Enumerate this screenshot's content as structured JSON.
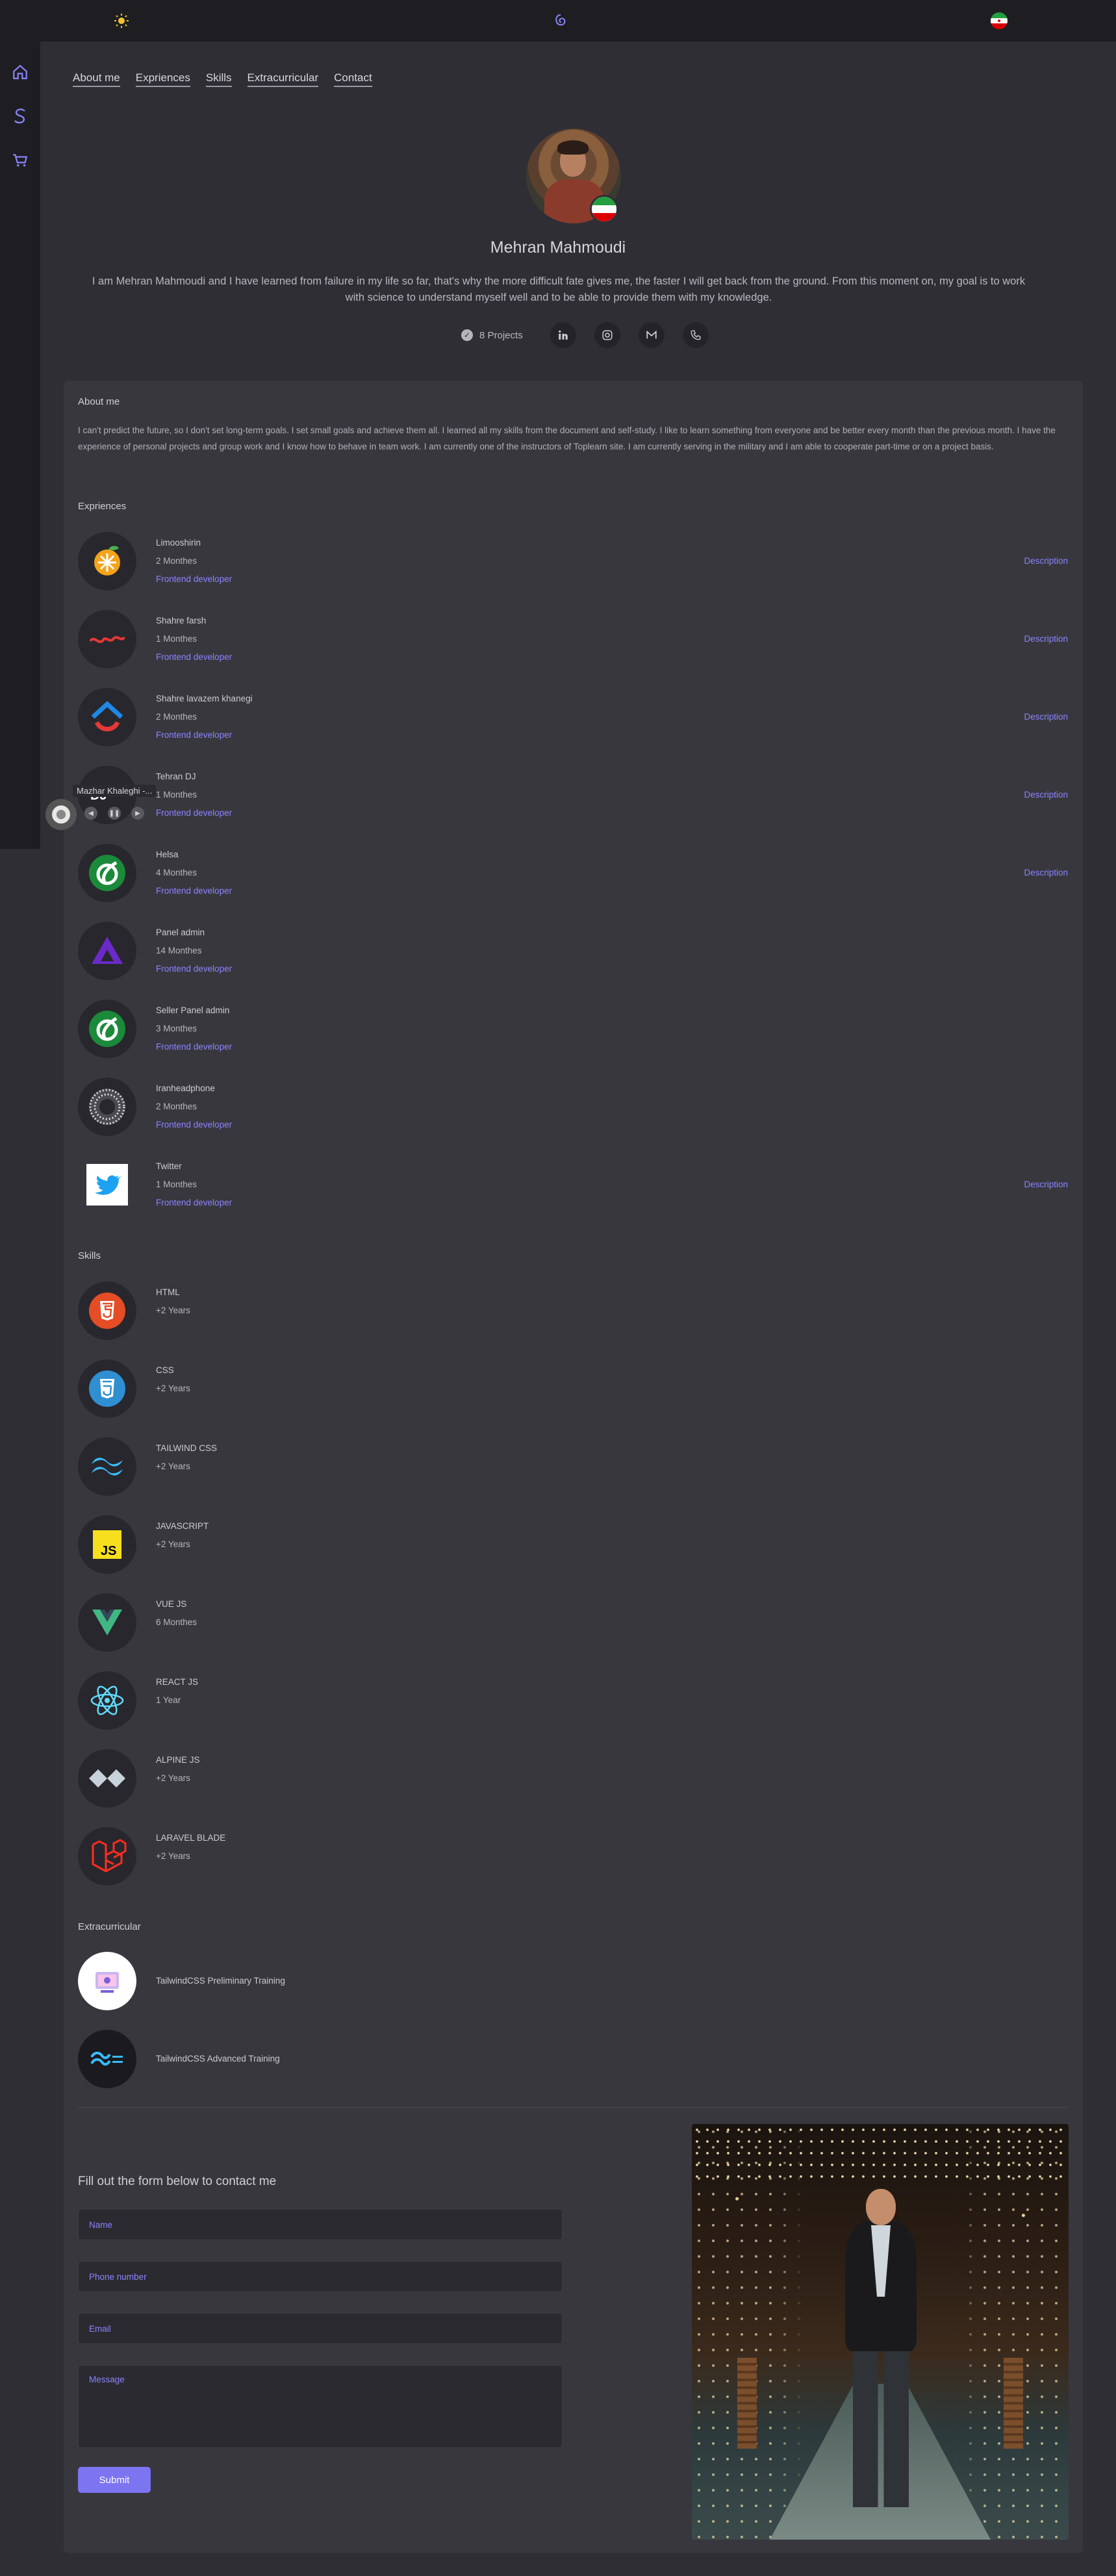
{
  "nav": [
    "About me",
    "Expriences",
    "Skills",
    "Extracurricular",
    "Contact"
  ],
  "profile": {
    "name": "Mehran Mahmoudi",
    "bio": "I am Mehran Mahmoudi and I have learned from failure in my life so far, that's why the more difficult fate gives me, the faster I will get back from the ground. From this moment on, my goal is to work with science to understand myself well and to be able to provide them with my knowledge.",
    "projects": "8 Projects"
  },
  "about": {
    "title": "About me",
    "text": "I can't predict the future, so I don't set long-term goals. I set small goals and achieve them all. I learned all my skills from the document and self-study. I like to learn something from everyone and be better every month than the previous month. I have the experience of personal projects and group work and I know how to behave in team work. I am currently one of the instructors of Toplearn site. I am currently serving in the military and I am able to cooperate part-time or on a project basis."
  },
  "experiences": {
    "title": "Expriences",
    "items": [
      {
        "name": "Limooshirin",
        "duration": "2 Monthes",
        "role": "Frontend developer",
        "link": "Description"
      },
      {
        "name": "Shahre farsh",
        "duration": "1 Monthes",
        "role": "Frontend developer",
        "link": "Description"
      },
      {
        "name": "Shahre lavazem khanegi",
        "duration": "2 Monthes",
        "role": "Frontend developer",
        "link": "Description"
      },
      {
        "name": "Tehran DJ",
        "duration": "1 Monthes",
        "role": "Frontend developer",
        "link": "Description"
      },
      {
        "name": "Helsa",
        "duration": "4 Monthes",
        "role": "Frontend developer",
        "link": "Description"
      },
      {
        "name": "Panel admin",
        "duration": "14 Monthes",
        "role": "Frontend developer",
        "link": ""
      },
      {
        "name": "Seller Panel admin",
        "duration": "3 Monthes",
        "role": "Frontend developer",
        "link": ""
      },
      {
        "name": "Iranheadphone",
        "duration": "2 Monthes",
        "role": "Frontend developer",
        "link": ""
      },
      {
        "name": "Twitter",
        "duration": "1 Monthes",
        "role": "Frontend developer",
        "link": "Description"
      }
    ]
  },
  "skills": {
    "title": "Skills",
    "items": [
      {
        "name": "HTML",
        "years": "+2 Years"
      },
      {
        "name": "CSS",
        "years": "+2 Years"
      },
      {
        "name": "TAILWIND CSS",
        "years": "+2 Years"
      },
      {
        "name": "JAVASCRIPT",
        "years": "+2 Years"
      },
      {
        "name": "VUE JS",
        "years": "6 Monthes"
      },
      {
        "name": "REACT JS",
        "years": "1 Year"
      },
      {
        "name": "ALPINE JS",
        "years": "+2 Years"
      },
      {
        "name": "LARAVEL BLADE",
        "years": "+2 Years"
      }
    ]
  },
  "extracurricular": {
    "title": "Extracurricular",
    "items": [
      "TailwindCSS Preliminary Training",
      "TailwindCSS Advanced Training"
    ]
  },
  "contact": {
    "title": "Fill out the form below to contact me",
    "name_placeholder": "Name",
    "phone_placeholder": "Phone number",
    "email_placeholder": "Email",
    "message_placeholder": "Message",
    "submit": "Submit"
  },
  "player": {
    "title": "Mazhar Khaleghi -..."
  },
  "colors": {
    "accent": "#8a84ff",
    "button": "#7c74f0",
    "bg": "#2f2e35",
    "card": "#38373e",
    "bar": "#1e1e22"
  },
  "icons": {
    "topbar": [
      "sun-icon",
      "logo-icon",
      "iran-flag-icon"
    ],
    "sidebar": [
      "home-icon",
      "s-logo-icon",
      "cart-icon"
    ],
    "social": [
      "linkedin-icon",
      "instagram-icon",
      "gmail-icon",
      "phone-icon"
    ]
  }
}
